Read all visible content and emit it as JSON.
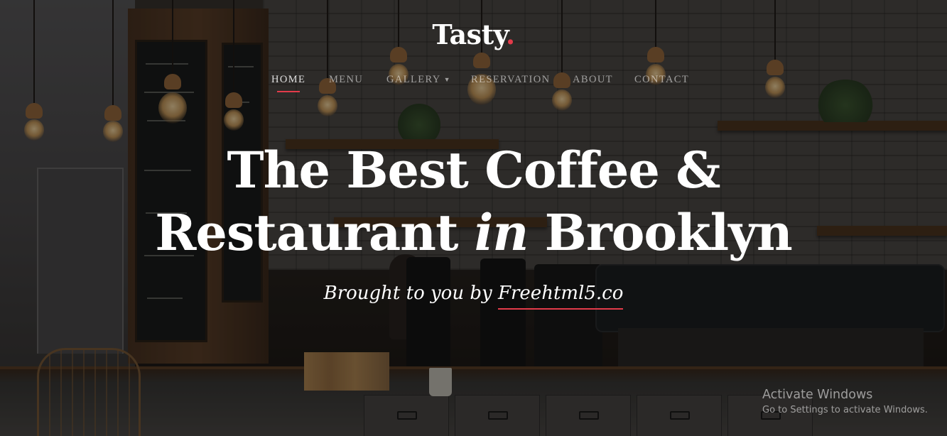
{
  "brand": {
    "name": "Tasty",
    "dot": ".",
    "dot_color": "#e33b4a"
  },
  "nav": {
    "items": [
      {
        "label": "HOME",
        "active": true
      },
      {
        "label": "MENU"
      },
      {
        "label": "GALLERY",
        "has_dropdown": true
      },
      {
        "label": "RESERVATION"
      },
      {
        "label": "ABOUT"
      },
      {
        "label": "CONTACT"
      }
    ]
  },
  "hero": {
    "headline_line1": "The Best Coffee &",
    "headline_line2_start": "Restaurant",
    "headline_line2_em": "in",
    "headline_line2_end": "Brooklyn",
    "tagline_prefix": "Brought to you by",
    "tagline_link": "Freehtml5.co",
    "background_description_icon": "cafe-interior-photo"
  },
  "watermark": {
    "title": "Activate Windows",
    "subtitle": "Go to Settings to activate Windows."
  },
  "colors": {
    "accent": "#e33b4a",
    "text": "#ffffff"
  }
}
